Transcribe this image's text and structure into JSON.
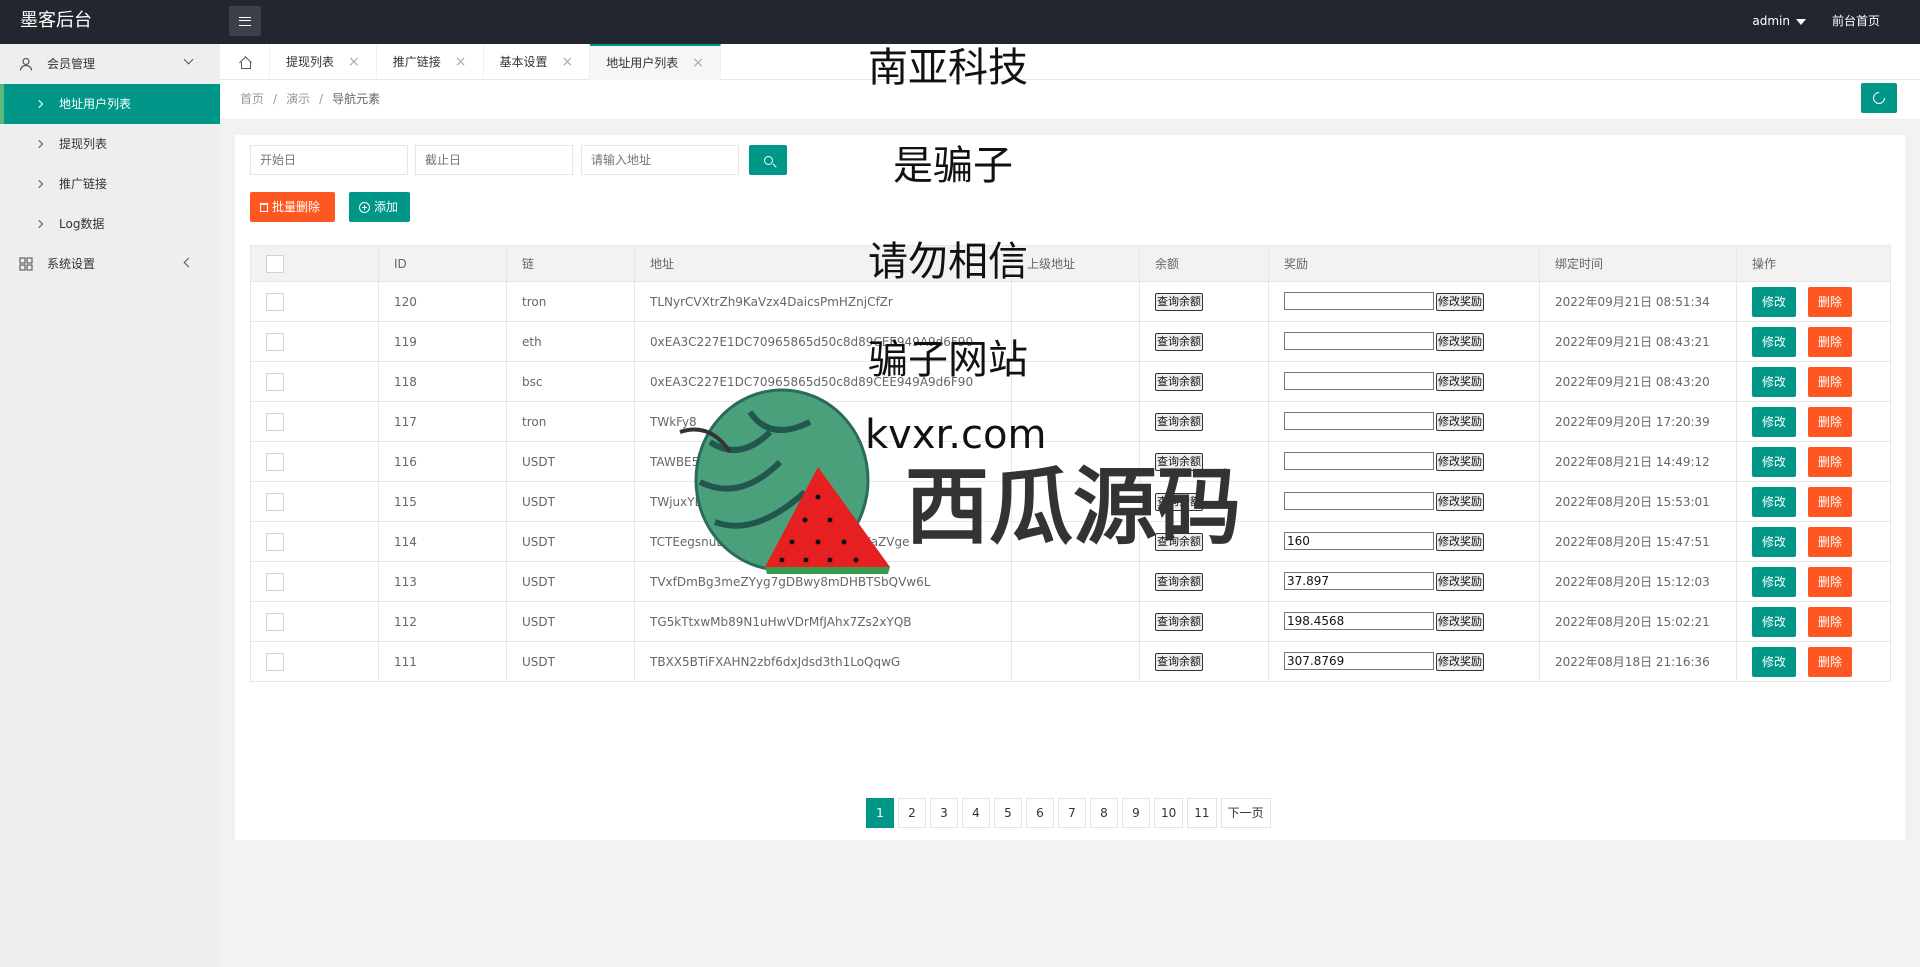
{
  "topbar": {
    "logo": "墨客后台",
    "user": "admin",
    "frontend_link": "前台首页"
  },
  "sidebar": {
    "group1": "会员管理",
    "items": [
      "地址用户列表",
      "提现列表",
      "推广链接",
      "Log数据"
    ],
    "group2": "系统设置"
  },
  "tabs": [
    "提现列表",
    "推广链接",
    "基本设置",
    "地址用户列表"
  ],
  "breadcrumb": [
    "首页",
    "演示",
    "导航元素"
  ],
  "filters": {
    "start_placeholder": "开始日",
    "end_placeholder": "截止日",
    "address_placeholder": "请输入地址"
  },
  "actions": {
    "batch_delete": "批量删除",
    "add": "添加"
  },
  "table": {
    "headers": [
      "ID",
      "链",
      "地址",
      "上级地址",
      "余额",
      "奖励",
      "绑定时间",
      "操作"
    ],
    "query_balance": "查询余额",
    "modify_reward": "修改奖励",
    "edit": "修改",
    "delete": "删除",
    "rows": [
      {
        "id": "120",
        "chain": "tron",
        "address": "TLNyrCVXtrZh9KaVzx4DaicsPmHZnjCfZr",
        "reward": "",
        "time": "2022年09月21日 08:51:34"
      },
      {
        "id": "119",
        "chain": "eth",
        "address": "0xEA3C227E1DC70965865d50c8d89CEE949A9d6F90",
        "reward": "",
        "time": "2022年09月21日 08:43:21"
      },
      {
        "id": "118",
        "chain": "bsc",
        "address": "0xEA3C227E1DC70965865d50c8d89CEE949A9d6F90",
        "reward": "",
        "time": "2022年09月21日 08:43:20"
      },
      {
        "id": "117",
        "chain": "tron",
        "address": "TWkFy8",
        "reward": "",
        "time": "2022年09月20日 17:20:39"
      },
      {
        "id": "116",
        "chain": "USDT",
        "address": "TAWBE5",
        "reward": "",
        "time": "2022年08月21日 14:49:12"
      },
      {
        "id": "115",
        "chain": "USDT",
        "address": "TWjuxYBxvZHAD",
        "reward": "",
        "time": "2022年08月20日 15:53:01"
      },
      {
        "id": "114",
        "chain": "USDT",
        "address": "TCTEegsnuEzXHqoRKTUMk62uLnvgKaZVge",
        "reward": "160",
        "time": "2022年08月20日 15:47:51"
      },
      {
        "id": "113",
        "chain": "USDT",
        "address": "TVxfDmBg3meZYyg7gDBwy8mDHBTSbQVw6L",
        "reward": "37.897",
        "time": "2022年08月20日 15:12:03"
      },
      {
        "id": "112",
        "chain": "USDT",
        "address": "TG5kTtxwMb89N1uHwVDrMfJAhx7Zs2xYQB",
        "reward": "198.4568",
        "time": "2022年08月20日 15:02:21"
      },
      {
        "id": "111",
        "chain": "USDT",
        "address": "TBXX5BTiFXAHN2zbf6dxJdsd3th1LoQqwG",
        "reward": "307.8769",
        "time": "2022年08月18日 21:16:36"
      }
    ]
  },
  "pagination": {
    "pages": [
      "1",
      "2",
      "3",
      "4",
      "5",
      "6",
      "7",
      "8",
      "9",
      "10",
      "11"
    ],
    "current": "1",
    "next": "下一页"
  },
  "overlay": {
    "lines": [
      "南亚科技",
      "是骗子",
      "请勿相信",
      "骗子网站"
    ],
    "watermark_domain": "kvxr.com",
    "watermark_brand": "西瓜源码"
  },
  "colors": {
    "primary": "#009688",
    "danger": "#ff5722",
    "topbar": "#23262e"
  }
}
